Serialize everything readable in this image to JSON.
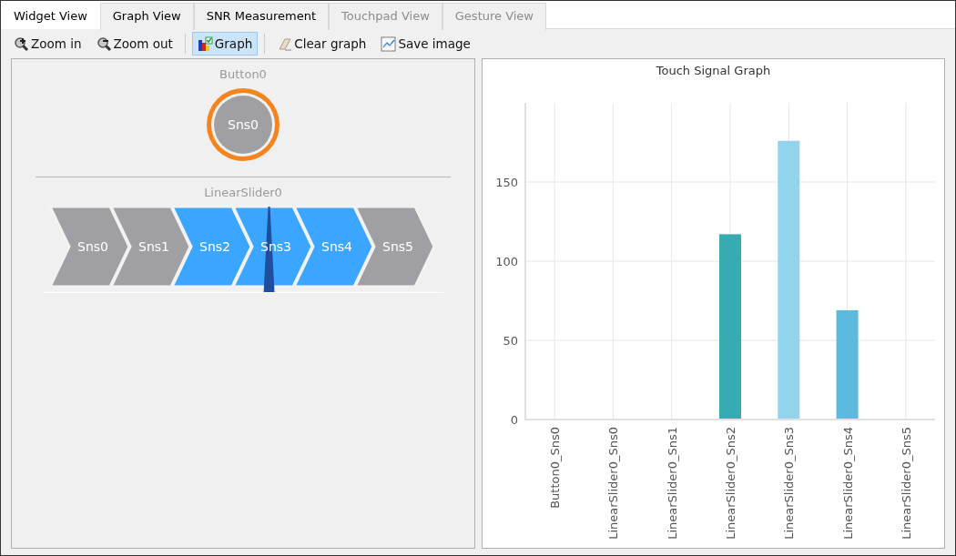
{
  "tabs": [
    {
      "label": "Widget View",
      "selected": true,
      "disabled": false
    },
    {
      "label": "Graph View",
      "selected": false,
      "disabled": false
    },
    {
      "label": "SNR Measurement",
      "selected": false,
      "disabled": false
    },
    {
      "label": "Touchpad View",
      "selected": false,
      "disabled": true
    },
    {
      "label": "Gesture View",
      "selected": false,
      "disabled": true
    }
  ],
  "toolbar": [
    {
      "kind": "zoom-in",
      "label": "Zoom in",
      "pressed": false
    },
    {
      "kind": "zoom-out",
      "label": "Zoom out",
      "pressed": false
    },
    {
      "kind": "separator"
    },
    {
      "kind": "graph",
      "label": "Graph",
      "pressed": true
    },
    {
      "kind": "separator"
    },
    {
      "kind": "clear",
      "label": "Clear graph",
      "pressed": false
    },
    {
      "kind": "save",
      "label": "Save image",
      "pressed": false
    }
  ],
  "widgets": {
    "button": {
      "title": "Button0",
      "sensor": "Sns0",
      "touched": true
    },
    "slider": {
      "title": "LinearSlider0",
      "level": 0.57,
      "sensors": [
        {
          "label": "Sns0",
          "active": false
        },
        {
          "label": "Sns1",
          "active": false
        },
        {
          "label": "Sns2",
          "active": true
        },
        {
          "label": "Sns3",
          "active": true
        },
        {
          "label": "Sns4",
          "active": true
        },
        {
          "label": "Sns5",
          "active": false
        }
      ]
    }
  },
  "graph": {
    "chart_data": {
      "type": "bar",
      "title": "Touch Signal Graph",
      "categories": [
        "Button0_Sns0",
        "LinearSlider0_Sns0",
        "LinearSlider0_Sns1",
        "LinearSlider0_Sns2",
        "LinearSlider0_Sns3",
        "LinearSlider0_Sns4",
        "LinearSlider0_Sns5"
      ],
      "values": [
        0,
        0,
        0,
        117,
        176,
        69,
        0
      ],
      "colors": [
        null,
        null,
        null,
        "#37abb2",
        "#93d3ec",
        "#5bbade",
        null
      ],
      "grid": true,
      "ylim": [
        0,
        200
      ],
      "yticks": [
        0,
        50,
        100,
        150
      ]
    }
  }
}
